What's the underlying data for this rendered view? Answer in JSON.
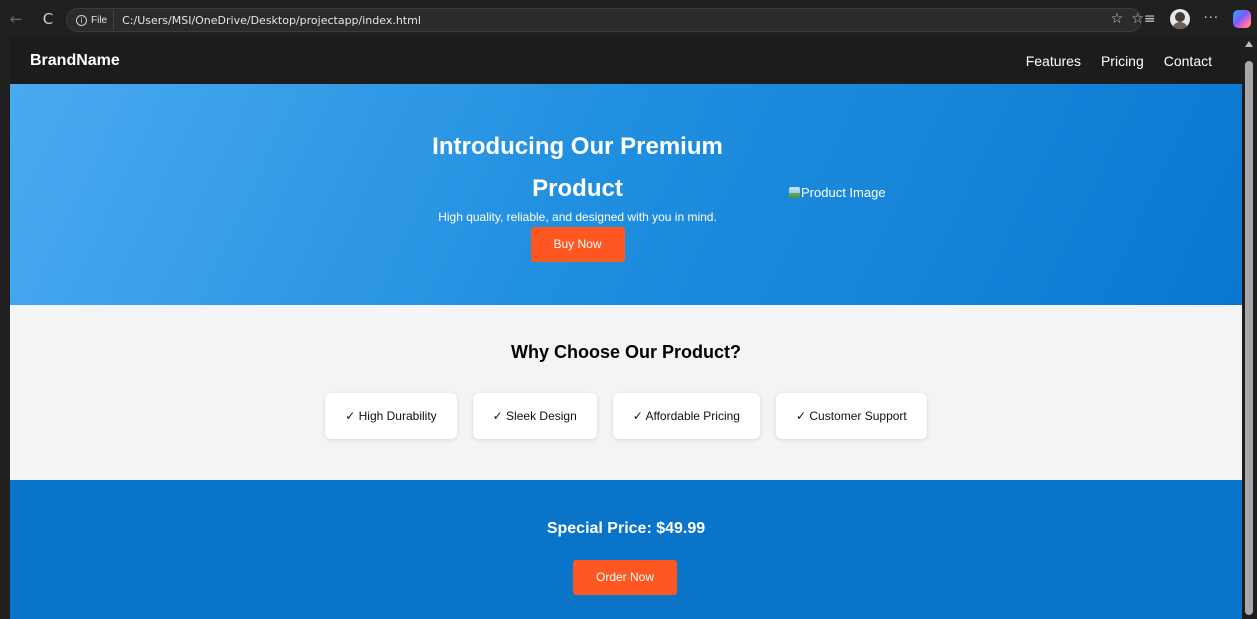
{
  "browser": {
    "back_icon": "←",
    "reload_icon": "C",
    "info_icon": "i",
    "file_label": "File",
    "url": "C:/Users/MSI/OneDrive/Desktop/projectapp/index.html",
    "star_icon": "☆",
    "favorites_icon": "☆≡",
    "more_icon": "···"
  },
  "site_nav": {
    "brand": "BrandName",
    "links": [
      "Features",
      "Pricing",
      "Contact"
    ]
  },
  "hero": {
    "title": "Introducing Our Premium Product",
    "subtitle": "High quality, reliable, and designed with you in mind.",
    "button": "Buy Now",
    "image_alt": "Product Image"
  },
  "features": {
    "title": "Why Choose Our Product?",
    "items": [
      "✓ High Durability",
      "✓ Sleek Design",
      "✓ Affordable Pricing",
      "✓ Customer Support"
    ]
  },
  "pricing": {
    "title": "Special Price: $49.99",
    "button": "Order Now"
  },
  "colors": {
    "accent": "#ff5722",
    "nav_bg": "#1c1c1c",
    "pricing_bg": "#0a74c8"
  }
}
